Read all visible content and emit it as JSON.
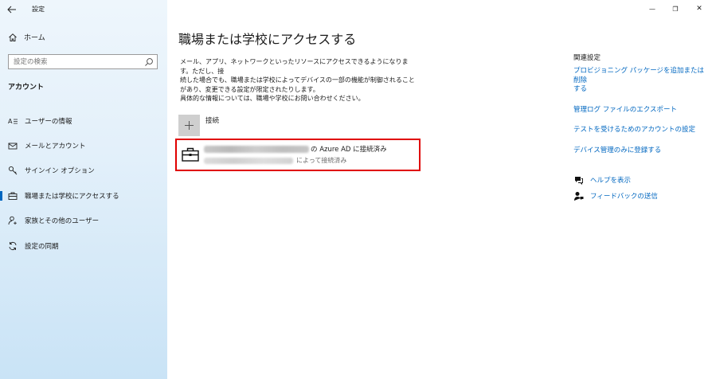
{
  "window": {
    "title": "設定",
    "controls": {
      "minimize": "—",
      "restore": "❐",
      "close": "✕"
    }
  },
  "sidebar": {
    "home_label": "ホーム",
    "search_placeholder": "設定の検索",
    "section_label": "アカウント",
    "items": [
      {
        "label": "ユーザーの情報",
        "icon": "user-card-icon"
      },
      {
        "label": "メールとアカウント",
        "icon": "mail-icon"
      },
      {
        "label": "サインイン オプション",
        "icon": "key-icon"
      },
      {
        "label": "職場または学校にアクセスする",
        "icon": "briefcase-icon",
        "active": true
      },
      {
        "label": "家族とその他のユーザー",
        "icon": "person-add-icon"
      },
      {
        "label": "設定の同期",
        "icon": "sync-icon"
      }
    ]
  },
  "main": {
    "title": "職場または学校にアクセスする",
    "description": [
      "メール、アプリ、ネットワークといったリソースにアクセスできるようになります。ただし、接",
      "続した場合でも、職場または学校によってデバイスの一部の機能が制御されること",
      "があり、変更できる設定が限定されたりします。",
      "具体的な情報については、職場や学校にお問い合わせください。"
    ],
    "connect_label": "接続",
    "account": {
      "line1_suffix": "の Azure AD に接続済み",
      "line2_suffix": "によって接続済み"
    }
  },
  "related": {
    "heading": "関連設定",
    "links": [
      [
        "プロビジョニング パッケージを追加または削除",
        "する"
      ],
      [
        "管理ログ ファイルのエクスポート"
      ],
      [
        "テストを受けるためのアカウントの設定"
      ],
      [
        "デバイス管理のみに登録する"
      ]
    ]
  },
  "help": {
    "items": [
      {
        "label": "ヘルプを表示",
        "icon": "help-chat-icon"
      },
      {
        "label": "フィードバックの送信",
        "icon": "feedback-icon"
      }
    ]
  }
}
